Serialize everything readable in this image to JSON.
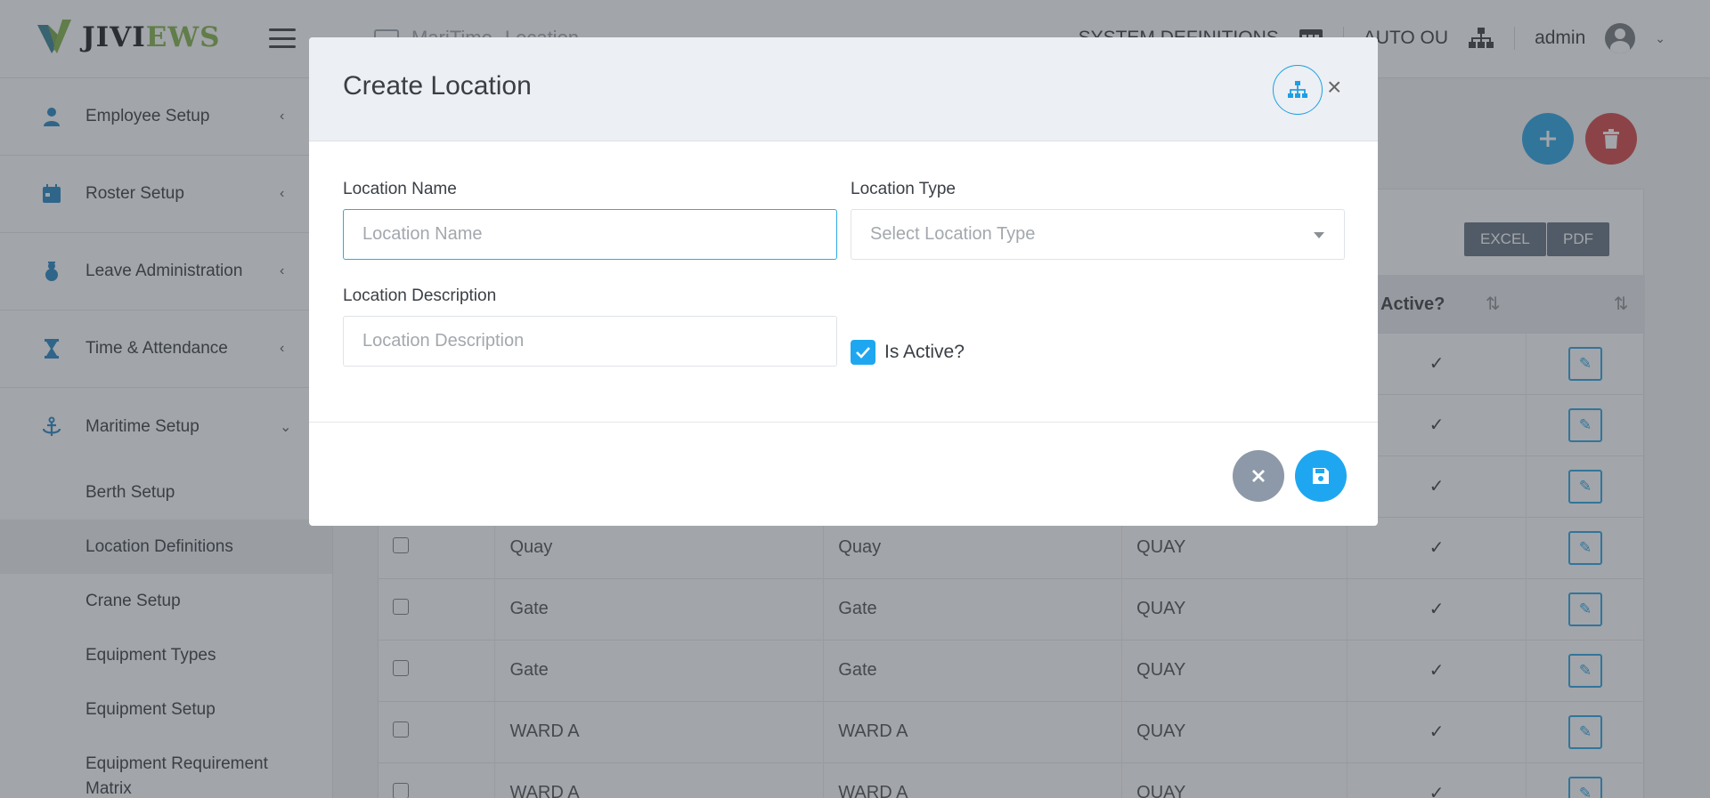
{
  "app": {
    "logo_prefix": "JIVI",
    "logo_suffix": "EWS"
  },
  "header": {
    "breadcrumb_parent": "MariTime",
    "breadcrumb_current": "Location",
    "system_definitions": "SYSTEM DEFINITIONS",
    "auto_ou": "AUTO OU",
    "user": "admin"
  },
  "sidebar": {
    "items": [
      {
        "label": "Employee Setup",
        "icon": "user-icon"
      },
      {
        "label": "Roster Setup",
        "icon": "calendar-icon"
      },
      {
        "label": "Leave Administration",
        "icon": "snowman-icon"
      },
      {
        "label": "Time & Attendance",
        "icon": "hourglass-icon"
      },
      {
        "label": "Maritime Setup",
        "icon": "anchor-icon"
      }
    ],
    "sub_items": [
      {
        "label": "Berth Setup"
      },
      {
        "label": "Location Definitions"
      },
      {
        "label": "Crane Setup"
      },
      {
        "label": "Equipment Types"
      },
      {
        "label": "Equipment Setup"
      },
      {
        "label": "Equipment Requirement Matrix"
      }
    ]
  },
  "toolbar": {
    "excel_label": "EXCEL",
    "pdf_label": "PDF"
  },
  "table": {
    "active_header": "Is Active?",
    "rows": [
      {
        "name": "",
        "description": "",
        "type": ""
      },
      {
        "name": "",
        "description": "",
        "type": ""
      },
      {
        "name": "",
        "description": "",
        "type": ""
      },
      {
        "name": "Quay",
        "description": "Quay",
        "type": "QUAY"
      },
      {
        "name": "Gate",
        "description": "Gate",
        "type": "QUAY"
      },
      {
        "name": "Gate",
        "description": "Gate",
        "type": "QUAY"
      },
      {
        "name": "WARD A",
        "description": "WARD A",
        "type": "QUAY"
      },
      {
        "name": "WARD A",
        "description": "WARD A",
        "type": "QUAY"
      }
    ]
  },
  "modal": {
    "title": "Create Location",
    "location_name_label": "Location Name",
    "location_name_placeholder": "Location Name",
    "location_name_value": "",
    "location_type_label": "Location Type",
    "location_type_placeholder": "Select Location Type",
    "location_description_label": "Location Description",
    "location_description_placeholder": "Location Description",
    "location_description_value": "",
    "is_active_label": "Is Active?",
    "is_active_checked": true
  },
  "colors": {
    "accent": "#1ea7f0",
    "danger": "#d23b3b",
    "cancel": "#8d99a8"
  }
}
